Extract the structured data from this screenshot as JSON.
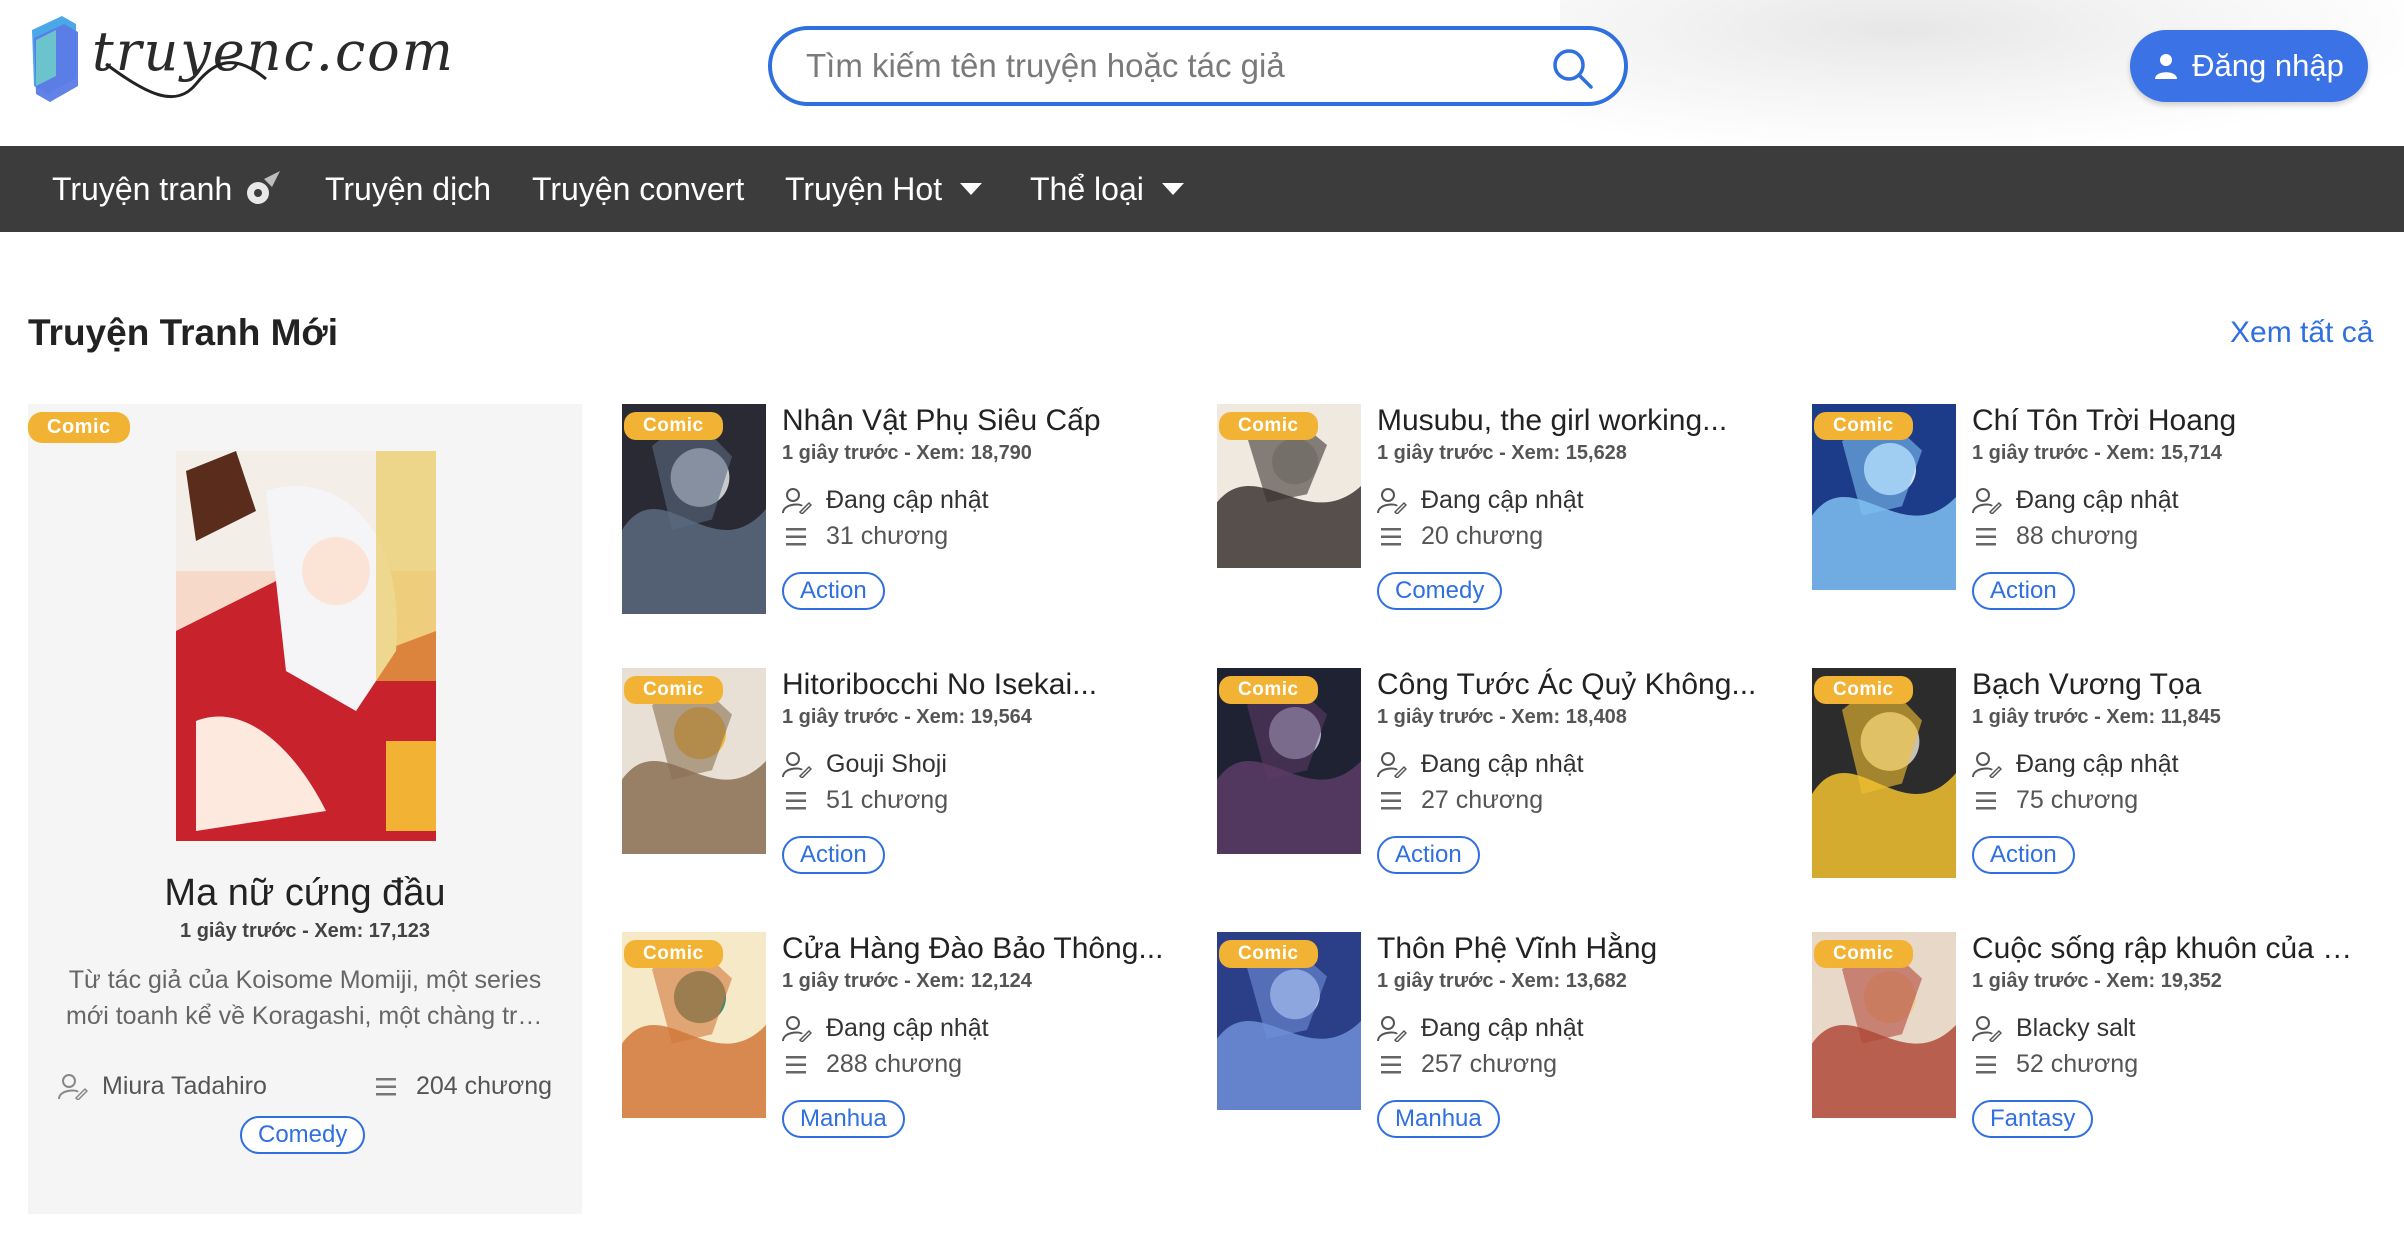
{
  "header": {
    "logo_text": "truyenc.com",
    "search_placeholder": "Tìm kiếm tên truyện hoặc tác giả",
    "login_label": "Đăng nhập"
  },
  "nav": {
    "items": [
      {
        "label": "Truyện tranh",
        "icon": "spinning-icon"
      },
      {
        "label": "Truyện dịch"
      },
      {
        "label": "Truyện convert"
      },
      {
        "label": "Truyện Hot",
        "dropdown": true
      },
      {
        "label": "Thể loại",
        "dropdown": true
      }
    ]
  },
  "section": {
    "title": "Truyện Tranh Mới",
    "see_all": "Xem tất cả"
  },
  "featured": {
    "badge": "Comic",
    "title": "Ma nữ cứng đầu",
    "meta": "1 giây trước - Xem: 17,123",
    "desc_line1": "Từ tác giả của Koisome Momiji, một series",
    "desc_line2": "mới toanh kể về Koragashi, một chàng tra..",
    "author": "Miura Tadahiro",
    "chapters": "204 chương",
    "tag": "Comic",
    "genre": "Comedy"
  },
  "cards": [
    {
      "badge": "Comic",
      "title": "Nhân Vật Phụ Siêu Cấp",
      "meta": "1 giây trước - Xem: 18,790",
      "author": "Đang cập nhật",
      "chapters": "31 chương",
      "genre": "Action"
    },
    {
      "badge": "Comic",
      "title": "Musubu, the girl working...",
      "meta": "1 giây trước - Xem: 15,628",
      "author": "Đang cập nhật",
      "chapters": "20 chương",
      "genre": "Comedy"
    },
    {
      "badge": "Comic",
      "title": "Chí Tôn Trời Hoang",
      "meta": "1 giây trước - Xem: 15,714",
      "author": "Đang cập nhật",
      "chapters": "88 chương",
      "genre": "Action"
    },
    {
      "badge": "Comic",
      "title": "Hitoribocchi No Isekai...",
      "meta": "1 giây trước - Xem: 19,564",
      "author": "Gouji Shoji",
      "chapters": "51 chương",
      "genre": "Action"
    },
    {
      "badge": "Comic",
      "title": "Công Tước Ác Quỷ Không...",
      "meta": "1 giây trước - Xem: 18,408",
      "author": "Đang cập nhật",
      "chapters": "27 chương",
      "genre": "Action"
    },
    {
      "badge": "Comic",
      "title": "Bạch Vương Tọa",
      "meta": "1 giây trước - Xem: 11,845",
      "author": "Đang cập nhật",
      "chapters": "75 chương",
      "genre": "Action"
    },
    {
      "badge": "Comic",
      "title": "Cửa Hàng Đào Bảo Thông...",
      "meta": "1 giây trước - Xem: 12,124",
      "author": "Đang cập nhật",
      "chapters": "288 chương",
      "genre": "Manhua"
    },
    {
      "badge": "Comic",
      "title": "Thôn Phệ Vĩnh Hằng",
      "meta": "1 giây trước - Xem: 13,682",
      "author": "Đang cập nhật",
      "chapters": "257 chương",
      "genre": "Manhua"
    },
    {
      "badge": "Comic",
      "title": "Cuộc sống rập khuôn của m...",
      "meta": "1 giây trước - Xem: 19,352",
      "author": "Blacky salt",
      "chapters": "52 chương",
      "genre": "Fantasy"
    }
  ],
  "colors": {
    "accent": "#2f6fe0",
    "badge": "#f2b233",
    "nav_bg": "#3c3c3c"
  }
}
